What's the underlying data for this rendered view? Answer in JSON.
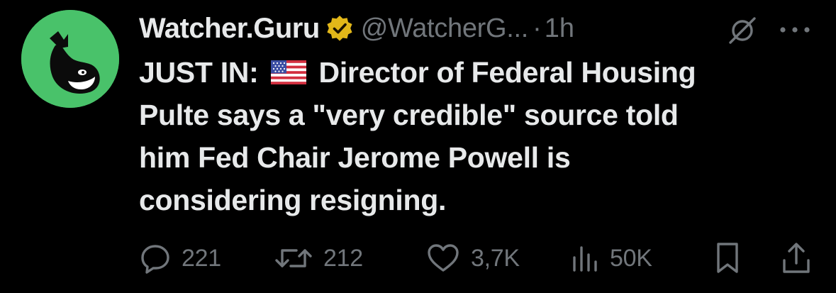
{
  "author": {
    "name": "Watcher.Guru",
    "handle": "@WatcherG...",
    "separator": "·",
    "time": "1h",
    "verified": true,
    "avatar_bg": "#49c26a",
    "verified_color": "#e2b719"
  },
  "tweet": {
    "lines": [
      {
        "before_flag": "JUST IN:",
        "after_flag": "Director of Federal Housing"
      },
      {
        "text": "Pulte says a \"very credible\" source told"
      },
      {
        "text": "him Fed Chair Jerome Powell is"
      },
      {
        "text": "considering resigning."
      }
    ],
    "flag": "us-flag-icon"
  },
  "actions": {
    "replies": "221",
    "reposts": "212",
    "likes": "3,7K",
    "views": "50K"
  },
  "colors": {
    "background": "#000000",
    "text_primary": "#e7e9ea",
    "text_secondary": "#71767b"
  },
  "icons": [
    "grok-icon",
    "more-icon",
    "reply-icon",
    "repost-icon",
    "like-icon",
    "views-icon",
    "bookmark-icon",
    "share-icon"
  ]
}
